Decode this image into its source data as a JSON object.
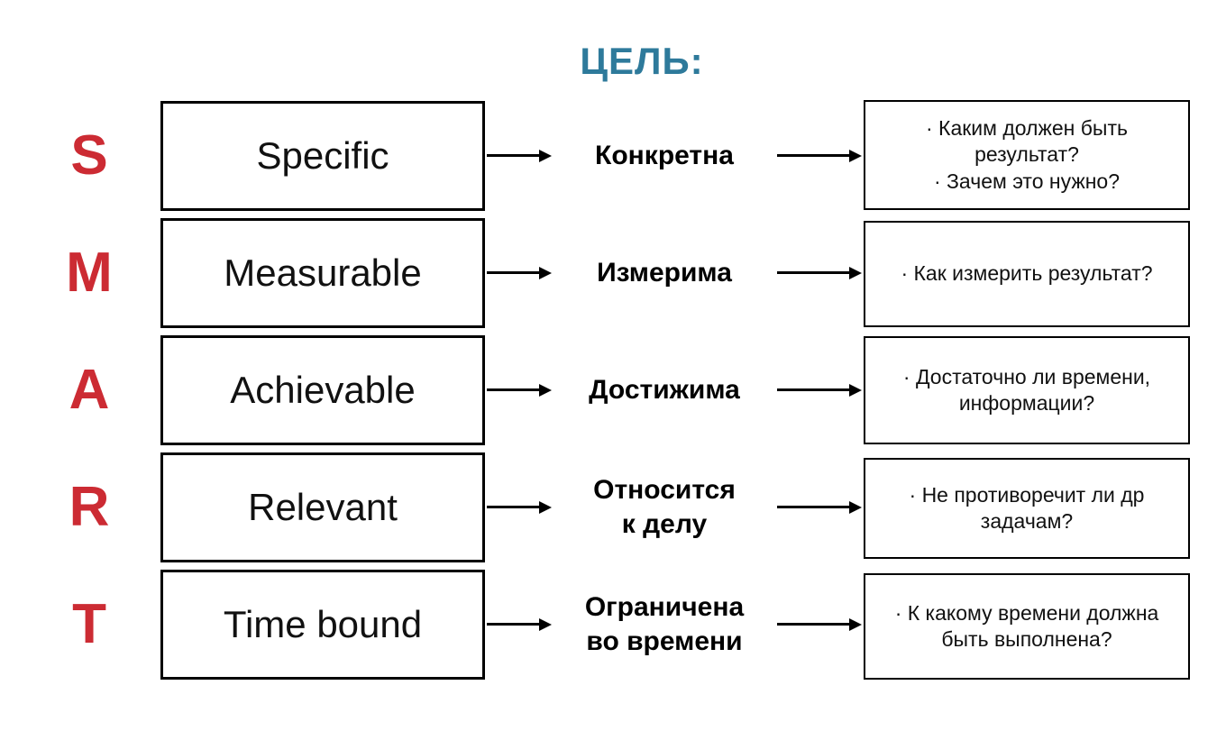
{
  "title": "ЦЕЛЬ:",
  "colors": {
    "title": "#2E7A9B",
    "letters": "#CC2B33",
    "text": "#111111",
    "border": "#000000",
    "background": "#FFFFFF"
  },
  "rows": [
    {
      "letter": "S",
      "term": "Specific",
      "ru_term_line1": "Конкретна",
      "ru_term_line2": "",
      "questions": [
        "· Каким должен быть результат?",
        "· Зачем это нужно?"
      ]
    },
    {
      "letter": "M",
      "term": "Measurable",
      "ru_term_line1": "Измерима",
      "ru_term_line2": "",
      "questions": [
        "· Как измерить результат?"
      ]
    },
    {
      "letter": "A",
      "term": "Achievable",
      "ru_term_line1": "Достижима",
      "ru_term_line2": "",
      "questions": [
        "· Достаточно ли времени, информации?"
      ]
    },
    {
      "letter": "R",
      "term": "Relevant",
      "ru_term_line1": "Относится",
      "ru_term_line2": "к делу",
      "questions": [
        "· Не противоречит ли др задачам?"
      ]
    },
    {
      "letter": "T",
      "term": "Time bound",
      "ru_term_line1": "Ограничена",
      "ru_term_line2": "во времени",
      "questions": [
        "· К какому времени должна быть выполнена?"
      ]
    }
  ]
}
